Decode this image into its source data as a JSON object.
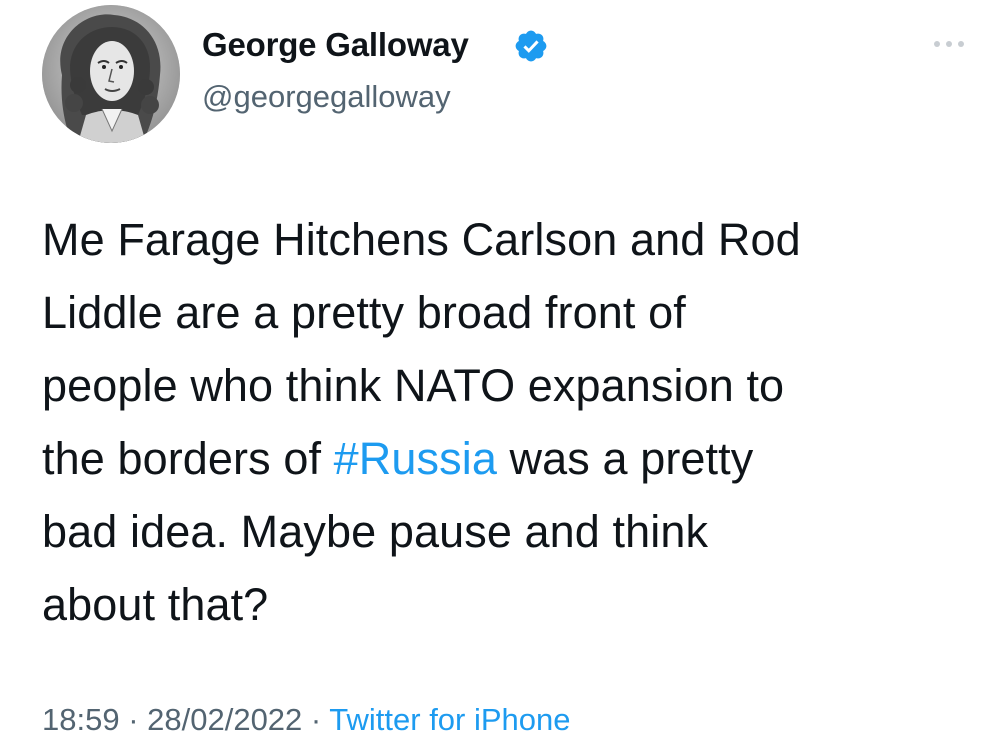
{
  "author": {
    "display_name": "George Galloway",
    "handle": "@georgegalloway",
    "verified": true,
    "avatar": "portrait-engraving-avatar"
  },
  "menu_icon": "more-options-icon",
  "tweet": {
    "lines": [
      [
        "Me Farage Hitchens Carlson and Rod"
      ],
      [
        "Liddle are a pretty broad front of"
      ],
      [
        "people who think NATO expansion to"
      ],
      [
        "the borders of ",
        "#Russia",
        " was a pretty"
      ],
      [
        "bad idea. Maybe pause and think"
      ],
      [
        "about that?"
      ]
    ],
    "l1": "Me Farage Hitchens Carlson and Rod",
    "l2": "Liddle are a pretty broad front of",
    "l3": "people who think NATO expansion to",
    "l4_pre": "the borders of ",
    "hashtag": "#Russia",
    "l4_post": " was a pretty",
    "l5": "bad idea. Maybe pause and think",
    "l6": "about that?"
  },
  "meta": {
    "time": "18:59",
    "sep1": " · ",
    "date": "28/02/2022",
    "sep2": " · ",
    "source": "Twitter for iPhone"
  },
  "colors": {
    "text": "#0f1419",
    "secondary": "#536471",
    "link": "#1d9bf0",
    "verified": "#1d9bf0"
  }
}
